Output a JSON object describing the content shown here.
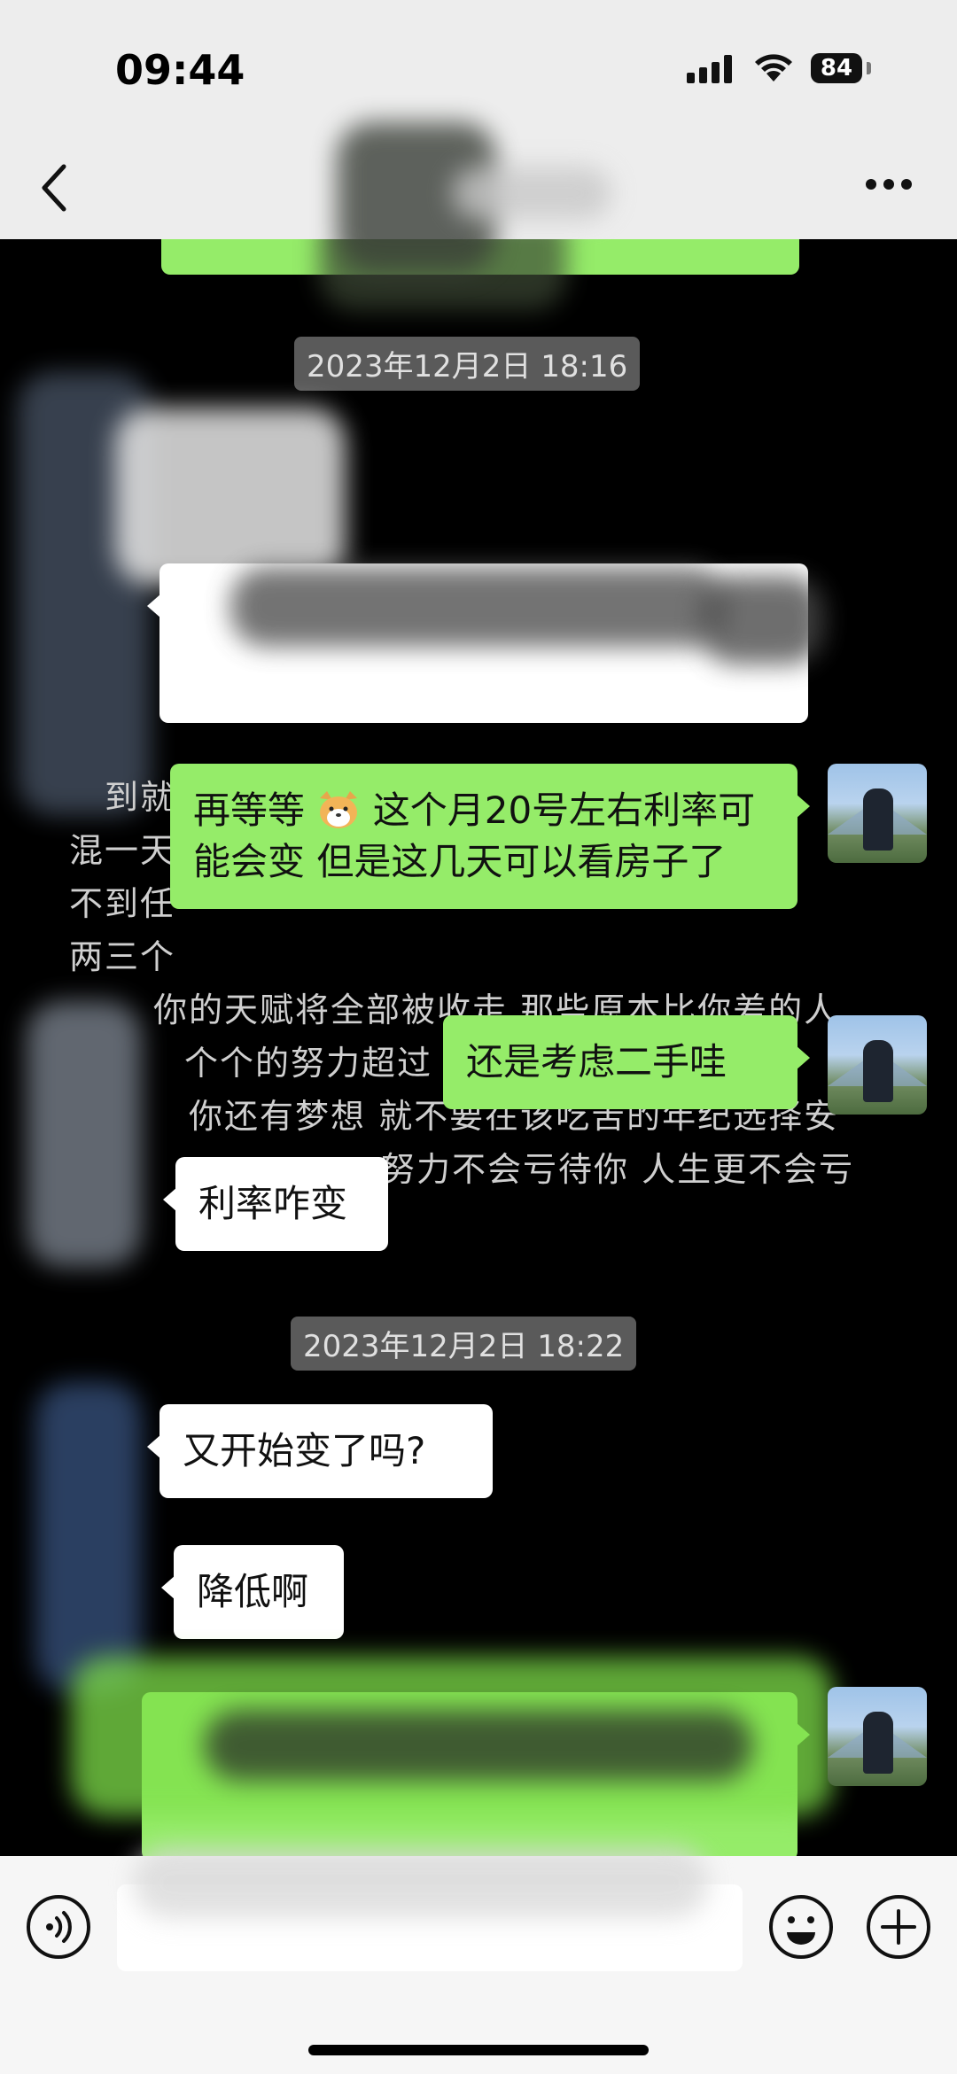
{
  "status": {
    "time": "09:44",
    "battery": "84"
  },
  "nav": {
    "title": ""
  },
  "background_text": [
    "到就",
    "混一天",
    "不到任",
    "两三个",
    "你的天赋将全部被收走 那些原本比你差的人",
    "个个的努力超过",
    "你还有梦想 就不要在该吃苦的年纪选择安",
    "努力不会亏待你 人生更不会亏"
  ],
  "messages": {
    "timestamp1": "2023年12月2日 18:16",
    "timestamp2": "2023年12月2日 18:22",
    "mine1_a": "再等等",
    "mine1_b": "这个月20号左右利率可能会变  但是这几天可以看房子了",
    "mine2": "还是考虑二手哇",
    "theirs1": "利率咋变",
    "theirs2": "又开始变了吗?",
    "theirs3": "降低啊"
  },
  "colors": {
    "mine_bubble": "#95ec69",
    "theirs_bubble": "#ffffff",
    "chat_background": "#000000",
    "bar_background": "#ededed"
  }
}
